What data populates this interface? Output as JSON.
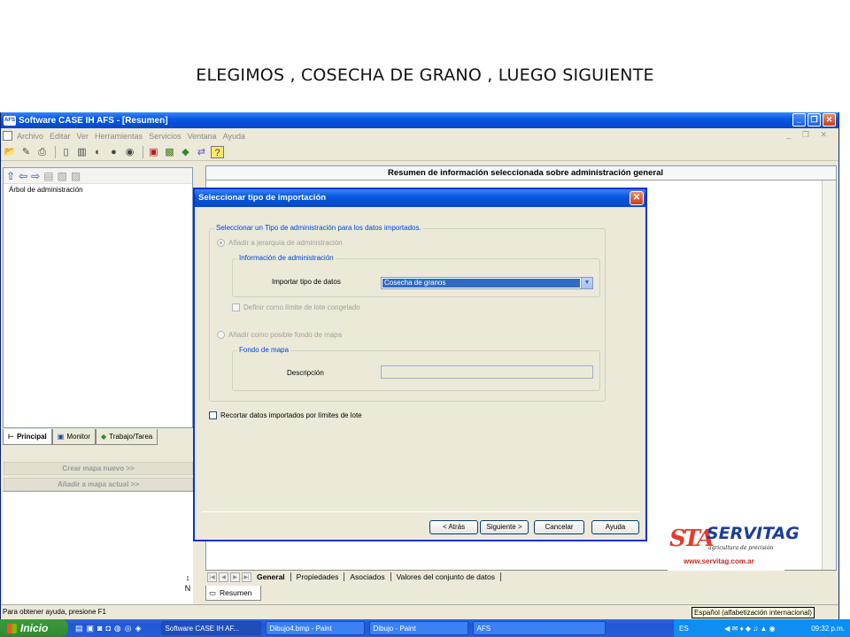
{
  "caption": "ELEGIMOS , COSECHA DE GRANO  , LUEGO SIGUIENTE",
  "window": {
    "app_icon": "AFS",
    "title": "Software CASE IH AFS - [Resumen]",
    "menu": [
      "Archivo",
      "Editar",
      "Ver",
      "Herramientas",
      "Servicios",
      "Ventana",
      "Ayuda"
    ]
  },
  "left_pane": {
    "tree_root": "Árbol de administración",
    "tabs": [
      "Principal",
      "Monitor",
      "Trabajo/Tarea"
    ],
    "create_map": "Crear mapa nuevo  >>",
    "add_to_map": "Añadir a mapa actual  >>"
  },
  "right_pane": {
    "header": "Resumen de información seleccionada sobre administración general",
    "tabs": [
      "General",
      "Propiedades",
      "Asociados",
      "Valores del conjunto de datos"
    ],
    "bottom_tab": "Resumen",
    "pane_label": "N"
  },
  "status_bar": "Para obtener ayuda, presione F1",
  "dialog": {
    "title": "Seleccionar tipo de importación",
    "outer_group_label": "Seleccionar un Tipo de administración para los datos importados.",
    "radio_hierarchy": "Añadir a jerarquía de administración",
    "admin_info_group": "Información de administración",
    "import_type_label": "Importar tipo de datos",
    "import_type_value": "Cosecha de granos",
    "frozen_limit": "Definir como límite de lote congelado",
    "radio_background": "Añadir como posible fondo de mapa",
    "background_group": "Fondo de mapa",
    "description_label": "Descripción",
    "description_value": "",
    "crop_checkbox": "Recortar datos importados por límites de lote",
    "buttons": {
      "back": "< Atrás",
      "next": "Siguiente >",
      "cancel": "Cancelar",
      "help": "Ayuda"
    }
  },
  "logo": {
    "mark": "STA",
    "name": "SERVITAG",
    "tagline": "agricultura de precisión",
    "url": "www.servitag.com.ar"
  },
  "taskbar": {
    "start": "Inicio",
    "tasks": [
      "Software CASE IH AF...",
      "Dibujo4.bmp - Paint",
      "Dibujo - Paint",
      "AFS"
    ],
    "lang": "ES",
    "clock": "09:32 p.m.",
    "lang_tooltip": "Español (alfabetización internacional)"
  }
}
